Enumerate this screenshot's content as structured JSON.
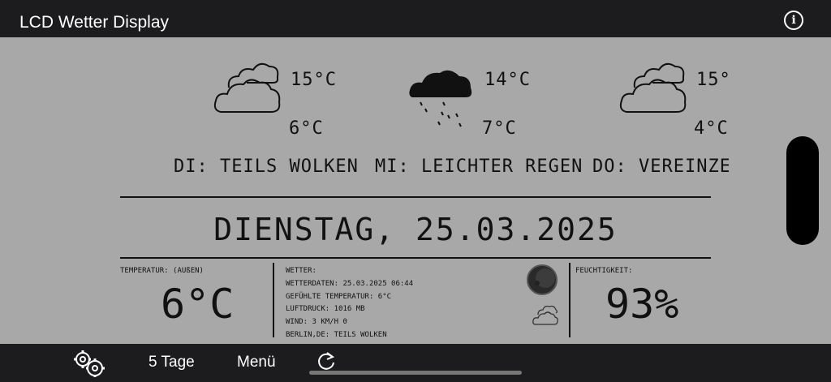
{
  "app": {
    "title": "LCD Wetter Display"
  },
  "icons": {
    "info": "info-icon",
    "settings": "gears-icon",
    "refresh": "refresh-icon"
  },
  "forecast": [
    {
      "icon": "partly-cloudy-icon",
      "high": "15°C",
      "low": "6°C",
      "label": "DI: TEILS WOLKEN"
    },
    {
      "icon": "rain-icon",
      "high": "14°C",
      "low": "7°C",
      "label": "MI: LEICHTER REGEN"
    },
    {
      "icon": "partly-cloudy-icon",
      "high": "15°C",
      "low": "4°C",
      "label": "DO: VEREINZELT L"
    }
  ],
  "date": "DIENSTAG, 25.03.2025",
  "temperature": {
    "label": "TEMPERATUR: (AUßEN)",
    "value": "6°C"
  },
  "weather": {
    "lines": [
      "WETTER:",
      "WETTERDATEN: 25.03.2025 06:44",
      "GEFÜHLTE TEMPERATUR: 6°C",
      "LUFTDRUCK: 1016 MB",
      "WIND: 3 KM/H 0",
      "BERLIN,DE: TEILS WOLKEN"
    ],
    "moon_icon": "moon-icon",
    "condition_icon": "cloud-icon"
  },
  "humidity": {
    "label": "FEUCHTIGKEIT:",
    "value": "93%"
  },
  "nav": {
    "tage": "5 Tage",
    "menu": "Menü"
  }
}
